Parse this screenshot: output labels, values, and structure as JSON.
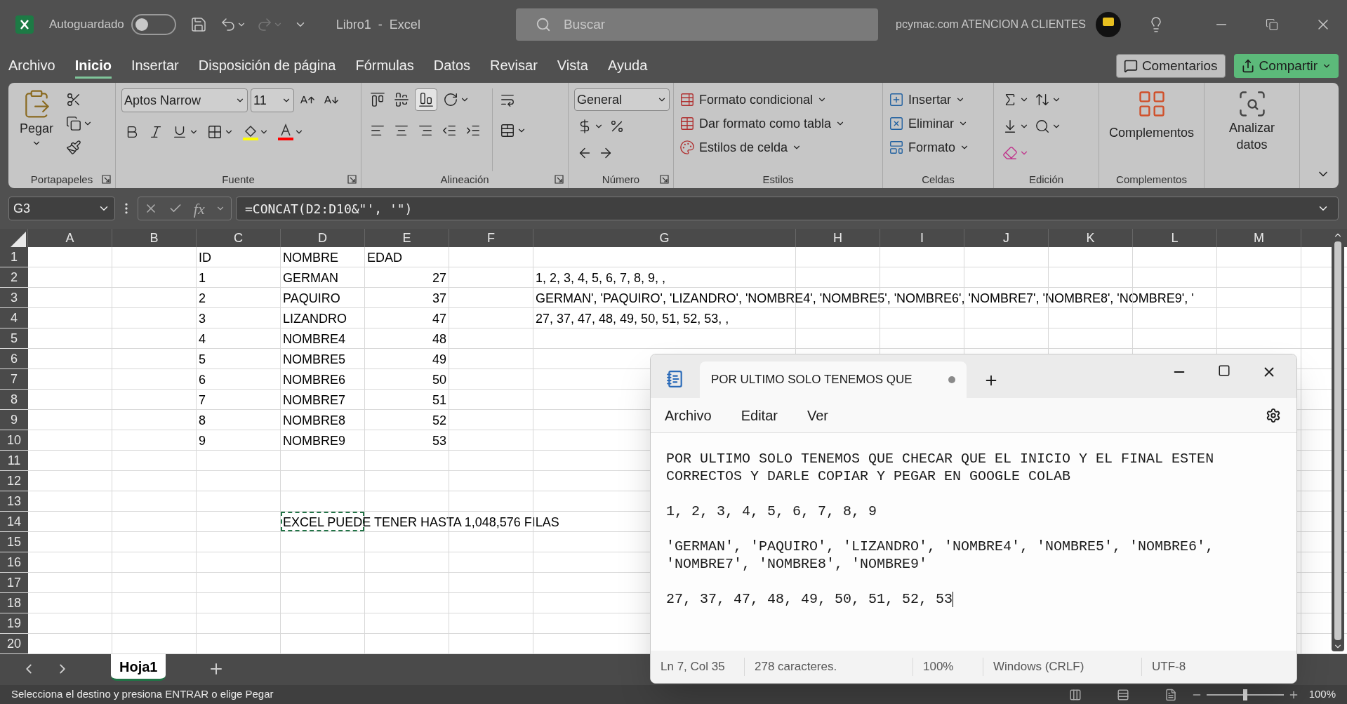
{
  "title_bar": {
    "autosave_label": "Autoguardado",
    "autosave_on": false,
    "title": "Libro1  -  Excel",
    "search_placeholder": "Buscar",
    "account": "pcymac.com ATENCION A CLIENTES"
  },
  "menu_tabs": [
    {
      "label": "Archivo",
      "selected": false
    },
    {
      "label": "Inicio",
      "selected": true
    },
    {
      "label": "Insertar",
      "selected": false
    },
    {
      "label": "Disposición de página",
      "selected": false
    },
    {
      "label": "Fórmulas",
      "selected": false
    },
    {
      "label": "Datos",
      "selected": false
    },
    {
      "label": "Revisar",
      "selected": false
    },
    {
      "label": "Vista",
      "selected": false
    },
    {
      "label": "Ayuda",
      "selected": false
    }
  ],
  "comments_button": "Comentarios",
  "share_button": "Compartir",
  "ribbon": {
    "clipboard": {
      "paste": "Pegar",
      "label": "Portapapeles"
    },
    "font": {
      "name": "Aptos Narrow",
      "size": "11",
      "label": "Fuente"
    },
    "alignment": {
      "vertical": [
        {
          "selected": false
        },
        {
          "selected": false
        },
        {
          "selected": true
        }
      ],
      "label": "Alineación"
    },
    "number": {
      "format": "General",
      "label": "Número"
    },
    "styles": {
      "items": [
        "Formato condicional",
        "Dar formato como tabla",
        "Estilos de celda"
      ],
      "label": "Estilos"
    },
    "cells": {
      "items": [
        "Insertar",
        "Eliminar",
        "Formato"
      ],
      "label": "Celdas"
    },
    "editing": {
      "label": "Edición"
    },
    "addins": {
      "button": "Complementos",
      "label": "Complementos"
    },
    "analyze": {
      "button": "Analizar datos"
    }
  },
  "formula_bar": {
    "name_box": "G3",
    "fx": "fx",
    "formula": "=CONCAT(D2:D10&\"', '\")"
  },
  "columns": [
    {
      "label": "A"
    },
    {
      "label": "B"
    },
    {
      "label": "C"
    },
    {
      "label": "D"
    },
    {
      "label": "E"
    },
    {
      "label": "F"
    },
    {
      "label": "G"
    },
    {
      "label": "H"
    },
    {
      "label": "I"
    },
    {
      "label": "J"
    },
    {
      "label": "K"
    },
    {
      "label": "L"
    },
    {
      "label": "M"
    }
  ],
  "rows": [
    {
      "header": "1",
      "cells": {
        "C": {
          "text": "ID",
          "kind": "text",
          "marquee": false
        },
        "D": {
          "text": "NOMBRE",
          "kind": "text",
          "marquee": false
        },
        "E": {
          "text": "EDAD",
          "kind": "text",
          "marquee": false
        }
      }
    },
    {
      "header": "2",
      "cells": {
        "C": {
          "text": "1",
          "kind": "text",
          "marquee": false
        },
        "D": {
          "text": "GERMAN",
          "kind": "text",
          "marquee": false
        },
        "E": {
          "text": "27",
          "kind": "number",
          "marquee": false
        },
        "G": {
          "text": "1, 2, 3, 4, 5, 6, 7, 8, 9, ,",
          "kind": "text",
          "marquee": false
        }
      }
    },
    {
      "header": "3",
      "cells": {
        "C": {
          "text": "2",
          "kind": "text",
          "marquee": false
        },
        "D": {
          "text": "PAQUIRO",
          "kind": "text",
          "marquee": false
        },
        "E": {
          "text": "37",
          "kind": "number",
          "marquee": false
        },
        "G": {
          "text": "GERMAN', 'PAQUIRO', 'LIZANDRO', 'NOMBRE4', 'NOMBRE5', 'NOMBRE6', 'NOMBRE7', 'NOMBRE8', 'NOMBRE9', '",
          "kind": "text",
          "marquee": false
        }
      }
    },
    {
      "header": "4",
      "cells": {
        "C": {
          "text": "3",
          "kind": "text",
          "marquee": false
        },
        "D": {
          "text": "LIZANDRO",
          "kind": "text",
          "marquee": false
        },
        "E": {
          "text": "47",
          "kind": "number",
          "marquee": false
        },
        "G": {
          "text": "27, 37, 47, 48, 49, 50, 51, 52, 53, ,",
          "kind": "text",
          "marquee": false
        }
      }
    },
    {
      "header": "5",
      "cells": {
        "C": {
          "text": "4",
          "kind": "text",
          "marquee": false
        },
        "D": {
          "text": "NOMBRE4",
          "kind": "text",
          "marquee": false
        },
        "E": {
          "text": "48",
          "kind": "number",
          "marquee": false
        }
      }
    },
    {
      "header": "6",
      "cells": {
        "C": {
          "text": "5",
          "kind": "text",
          "marquee": false
        },
        "D": {
          "text": "NOMBRE5",
          "kind": "text",
          "marquee": false
        },
        "E": {
          "text": "49",
          "kind": "number",
          "marquee": false
        }
      }
    },
    {
      "header": "7",
      "cells": {
        "C": {
          "text": "6",
          "kind": "text",
          "marquee": false
        },
        "D": {
          "text": "NOMBRE6",
          "kind": "text",
          "marquee": false
        },
        "E": {
          "text": "50",
          "kind": "number",
          "marquee": false
        }
      }
    },
    {
      "header": "8",
      "cells": {
        "C": {
          "text": "7",
          "kind": "text",
          "marquee": false
        },
        "D": {
          "text": "NOMBRE7",
          "kind": "text",
          "marquee": false
        },
        "E": {
          "text": "51",
          "kind": "number",
          "marquee": false
        }
      }
    },
    {
      "header": "9",
      "cells": {
        "C": {
          "text": "8",
          "kind": "text",
          "marquee": false
        },
        "D": {
          "text": "NOMBRE8",
          "kind": "text",
          "marquee": false
        },
        "E": {
          "text": "52",
          "kind": "number",
          "marquee": false
        }
      }
    },
    {
      "header": "10",
      "cells": {
        "C": {
          "text": "9",
          "kind": "text",
          "marquee": false
        },
        "D": {
          "text": "NOMBRE9",
          "kind": "text",
          "marquee": false
        },
        "E": {
          "text": "53",
          "kind": "number",
          "marquee": false
        }
      }
    },
    {
      "header": "11"
    },
    {
      "header": "12"
    },
    {
      "header": "13"
    },
    {
      "header": "14",
      "cells": {
        "D": {
          "text": "EXCEL PUEDE TENER HASTA 1,048,576 FILAS",
          "kind": "text",
          "marquee": true
        }
      }
    },
    {
      "header": "15"
    },
    {
      "header": "16"
    },
    {
      "header": "17"
    },
    {
      "header": "18"
    },
    {
      "header": "19"
    },
    {
      "header": "20"
    }
  ],
  "sheet_tabs": [
    {
      "label": "Hoja1",
      "selected": true
    }
  ],
  "status_bar": {
    "message": "Selecciona el destino y presiona ENTRAR o elige Pegar",
    "zoom": "100%",
    "zoom_slider": {
      "level": 0.5
    }
  },
  "notepad": {
    "tab_title": "POR ULTIMO SOLO TENEMOS QUE",
    "unsaved": true,
    "menu": [
      "Archivo",
      "Editar",
      "Ver"
    ],
    "paragraphs": [
      "POR ULTIMO SOLO TENEMOS QUE CHECAR QUE EL INICIO Y EL FINAL ESTEN CORRECTOS Y DARLE COPIAR Y PEGAR EN GOOGLE COLAB",
      "1, 2, 3, 4, 5, 6, 7, 8, 9",
      "'GERMAN', 'PAQUIRO', 'LIZANDRO', 'NOMBRE4', 'NOMBRE5', 'NOMBRE6', 'NOMBRE7', 'NOMBRE8', 'NOMBRE9'",
      "27, 37, 47, 48, 49, 50, 51, 52, 53"
    ],
    "status": [
      "Ln 7, Col 35",
      "278 caracteres.",
      "100%",
      "Windows (CRLF)",
      "UTF-8"
    ]
  }
}
